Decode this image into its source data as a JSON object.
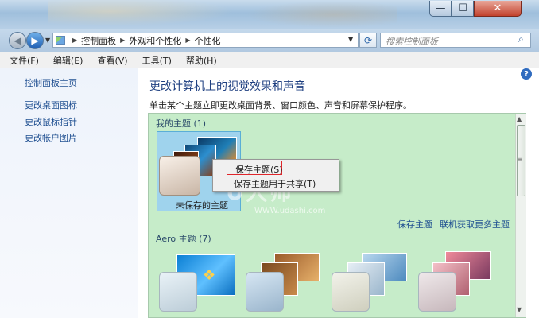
{
  "window": {
    "minimize_glyph": "—",
    "maximize_glyph": "☐",
    "close_glyph": "✕"
  },
  "address": {
    "crumbs": [
      "控制面板",
      "外观和个性化",
      "个性化"
    ],
    "separator": "▶",
    "back_icon": "◀",
    "forward_icon": "▶",
    "dropdown_icon": "▼",
    "refresh_icon": "⟳",
    "search_placeholder": "搜索控制面板",
    "search_icon": "⌕"
  },
  "menu": {
    "items": [
      "文件(F)",
      "编辑(E)",
      "查看(V)",
      "工具(T)",
      "帮助(H)"
    ]
  },
  "sidebar": {
    "items": [
      {
        "label": "控制面板主页"
      },
      {
        "label": "更改桌面图标"
      },
      {
        "label": "更改鼠标指针"
      },
      {
        "label": "更改帐户图片"
      }
    ]
  },
  "main": {
    "title": "更改计算机上的视觉效果和声音",
    "description": "单击某个主题立即更改桌面背景、窗口颜色、声音和屏幕保护程序。",
    "help_icon": "?",
    "my_themes_label": "我的主题 (1)",
    "unsaved_theme_label": "未保存的主题",
    "save_theme_link": "保存主题",
    "get_more_link": "联机获取更多主题",
    "aero_label": "Aero 主题 (7)"
  },
  "context_menu": {
    "items": [
      "保存主题(S)",
      "保存主题用于共享(T)"
    ]
  },
  "watermark": {
    "text": "U大师",
    "url": "WWW.udashi.com"
  },
  "scrollbar": {
    "up": "▲",
    "down": "▼",
    "grip": "≡"
  },
  "colors": {
    "theme_panel_bg": "#c6ecc9",
    "link": "#1f4f91",
    "title": "#1e3f80",
    "highlight_border": "#e0262b"
  }
}
